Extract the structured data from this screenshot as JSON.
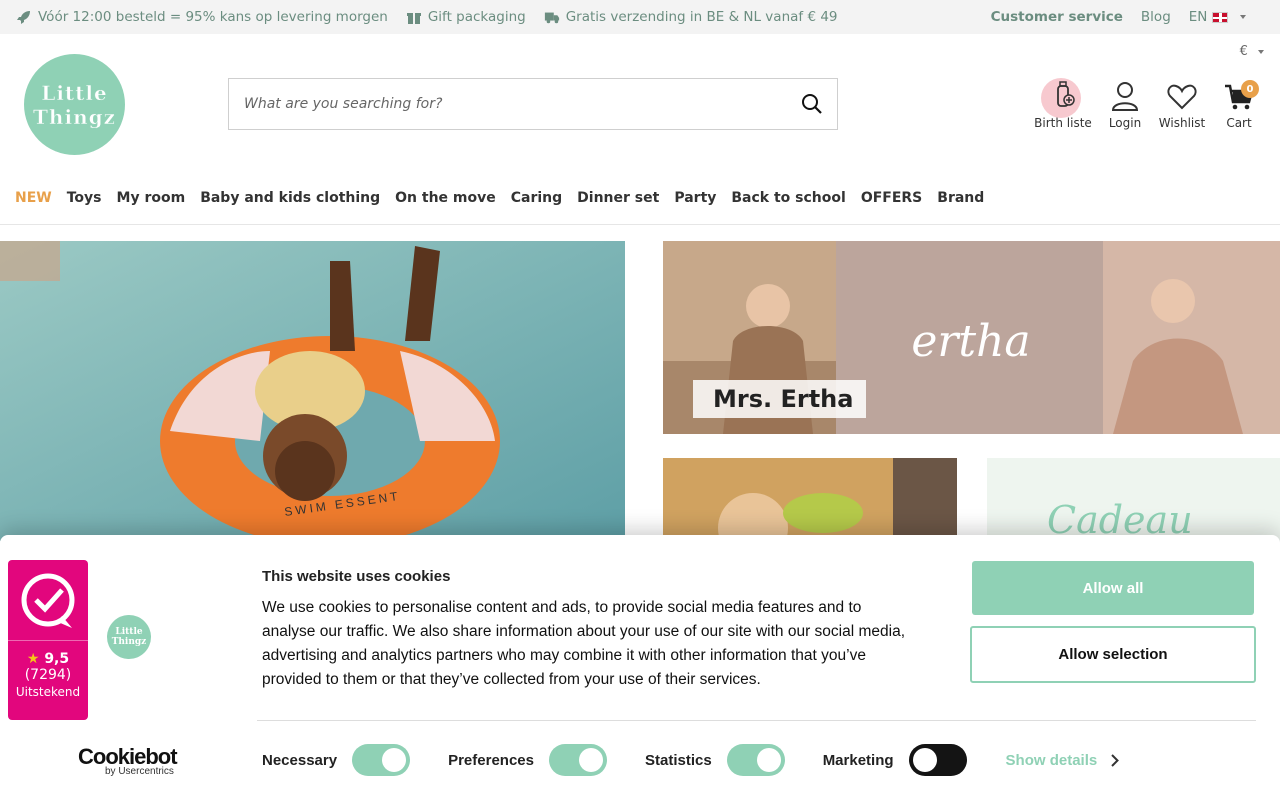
{
  "topbar": {
    "usp1": "Vóór 12:00 besteld = 95% kans op levering morgen",
    "usp2": "Gift packaging",
    "usp3": "Gratis verzending in BE & NL vanaf € 49",
    "customer_service": "Customer service",
    "blog": "Blog",
    "language": "EN"
  },
  "header": {
    "currency": "€",
    "logo_line1": "Little",
    "logo_line2": "Thingz",
    "search_placeholder": "What are you searching for?",
    "icons": {
      "birth": "Birth liste",
      "login": "Login",
      "wishlist": "Wishlist",
      "cart": "Cart",
      "cart_count": "0"
    }
  },
  "nav": [
    "NEW",
    "Toys",
    "My room",
    "Baby and kids clothing",
    "On the move",
    "Caring",
    "Dinner set",
    "Party",
    "Back to school",
    "OFFERS",
    "Brand"
  ],
  "banners": {
    "ertha_label": "Mrs. Ertha",
    "ertha_logo": "ertha",
    "swim_text": "SWIM ESSENT",
    "tile2_text": "Cadeau"
  },
  "cookie": {
    "title": "This website uses cookies",
    "text": "We use cookies to personalise content and ads, to provide social media features and to analyse our traffic. We also share information about your use of our site with our social media, advertising and analytics partners who may combine it with other information that you’ve provided to them or that they’ve collected from your use of their services.",
    "allow_all": "Allow all",
    "allow_selection": "Allow selection",
    "necessary": "Necessary",
    "preferences": "Preferences",
    "statistics": "Statistics",
    "marketing": "Marketing",
    "show_details": "Show details",
    "cookiebot": "Cookiebot",
    "cookiebot_by": "by Usercentrics"
  },
  "kiyoh": {
    "rating": "9,5",
    "count": "(7294)",
    "label": "Uitstekend"
  },
  "colors": {
    "brand_mint": "#8fd1b5",
    "accent_orange": "#e8a04a",
    "kiyoh_pink": "#e2067d"
  }
}
